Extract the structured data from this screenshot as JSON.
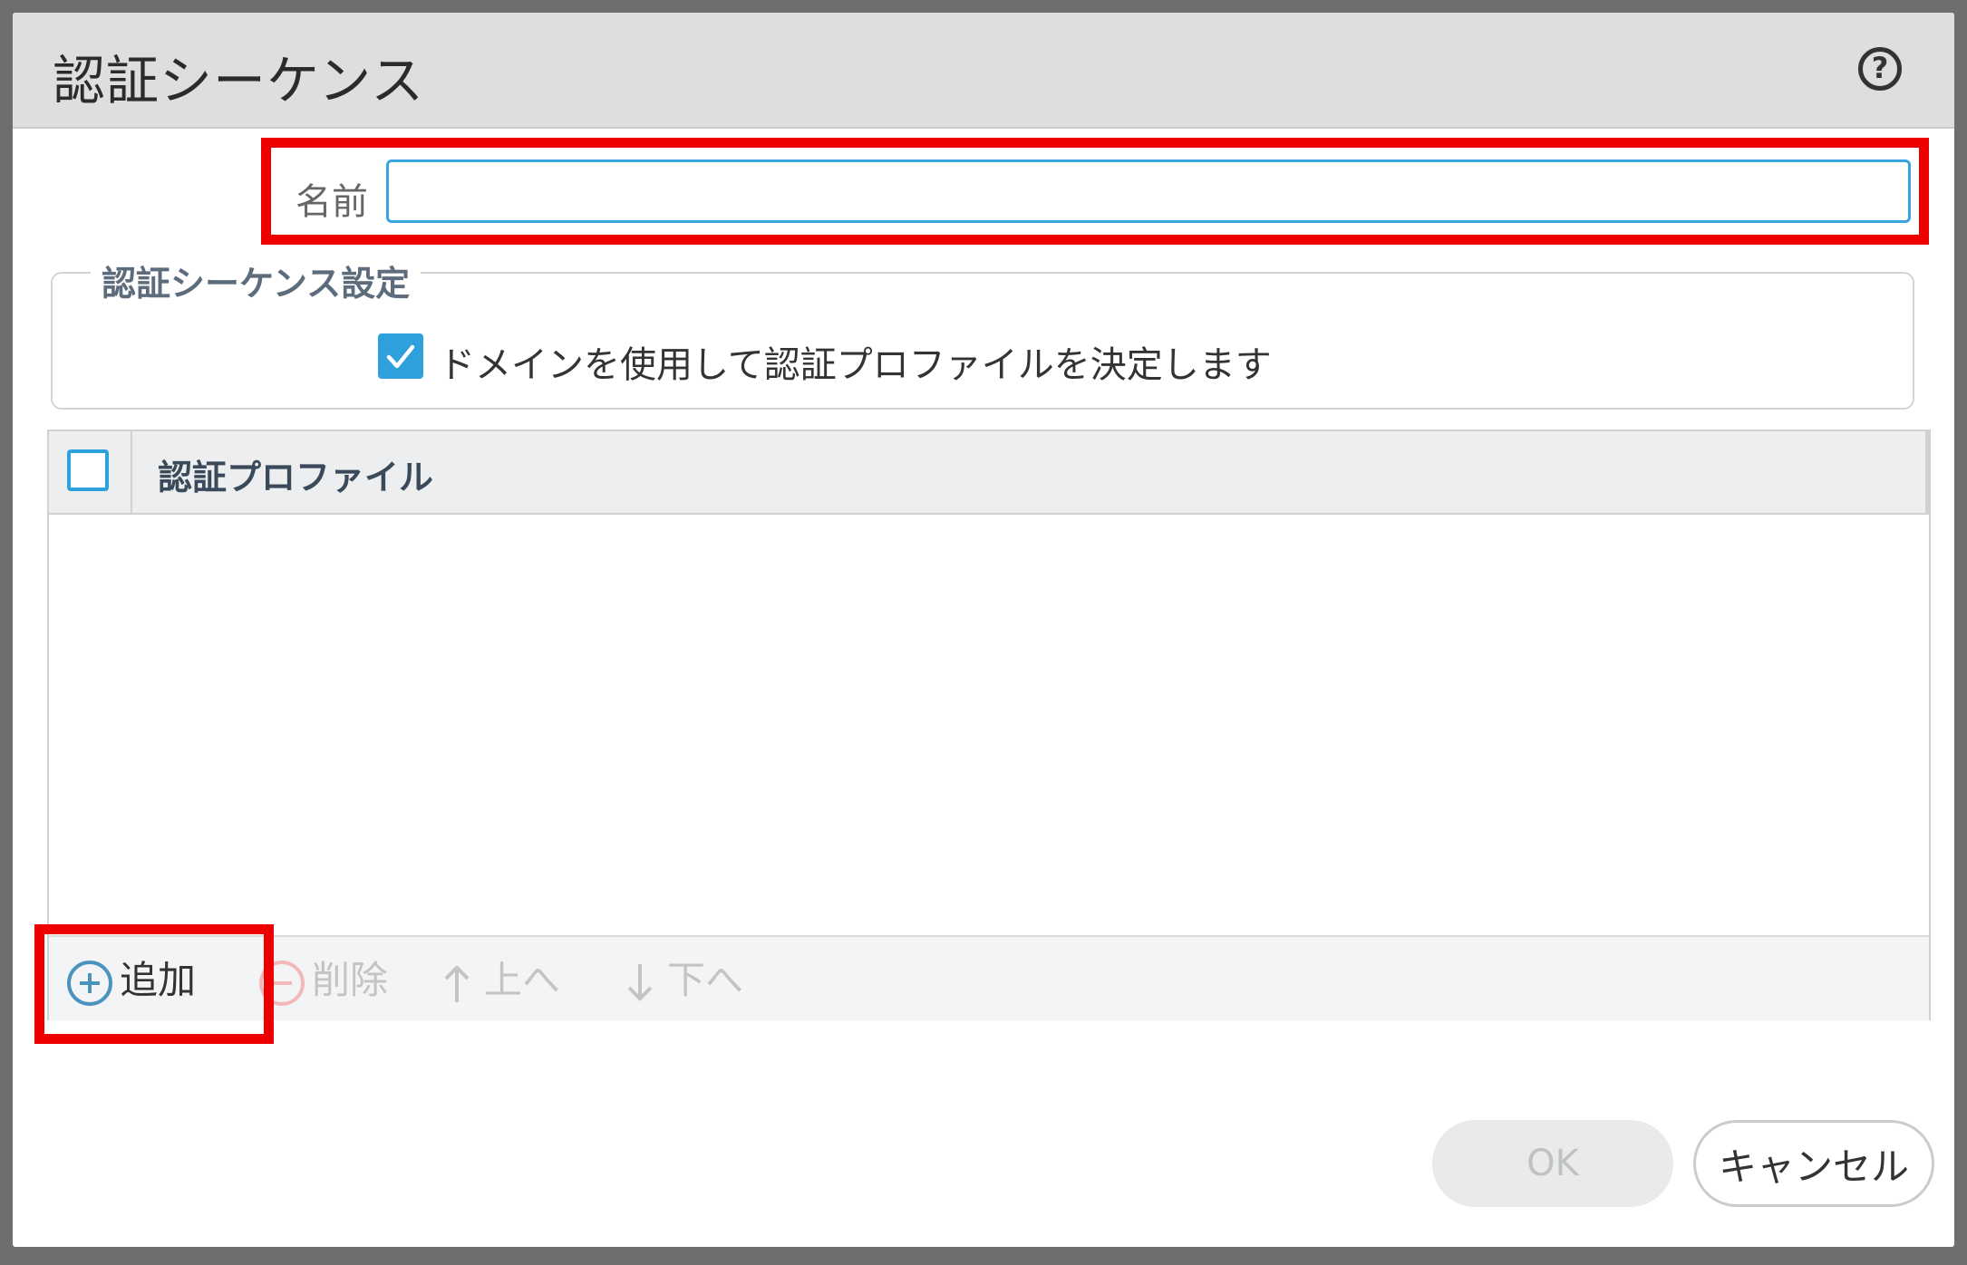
{
  "dialog": {
    "title": "認証シーケンス",
    "help_icon": "help-circle-icon"
  },
  "name_field": {
    "label": "名前",
    "value": "",
    "placeholder": ""
  },
  "settings": {
    "legend": "認証シーケンス設定",
    "use_domain_checkbox": {
      "label": "ドメインを使用して認証プロファイルを決定します",
      "checked": true
    }
  },
  "profile_table": {
    "column_header": "認証プロファイル",
    "rows": []
  },
  "toolbar": {
    "add_label": "追加",
    "delete_label": "削除",
    "up_label": "上へ",
    "down_label": "下へ"
  },
  "footer": {
    "ok_label": "OK",
    "cancel_label": "キャンセル"
  },
  "colors": {
    "accent": "#2ea0dc",
    "highlight": "#ee0000"
  }
}
